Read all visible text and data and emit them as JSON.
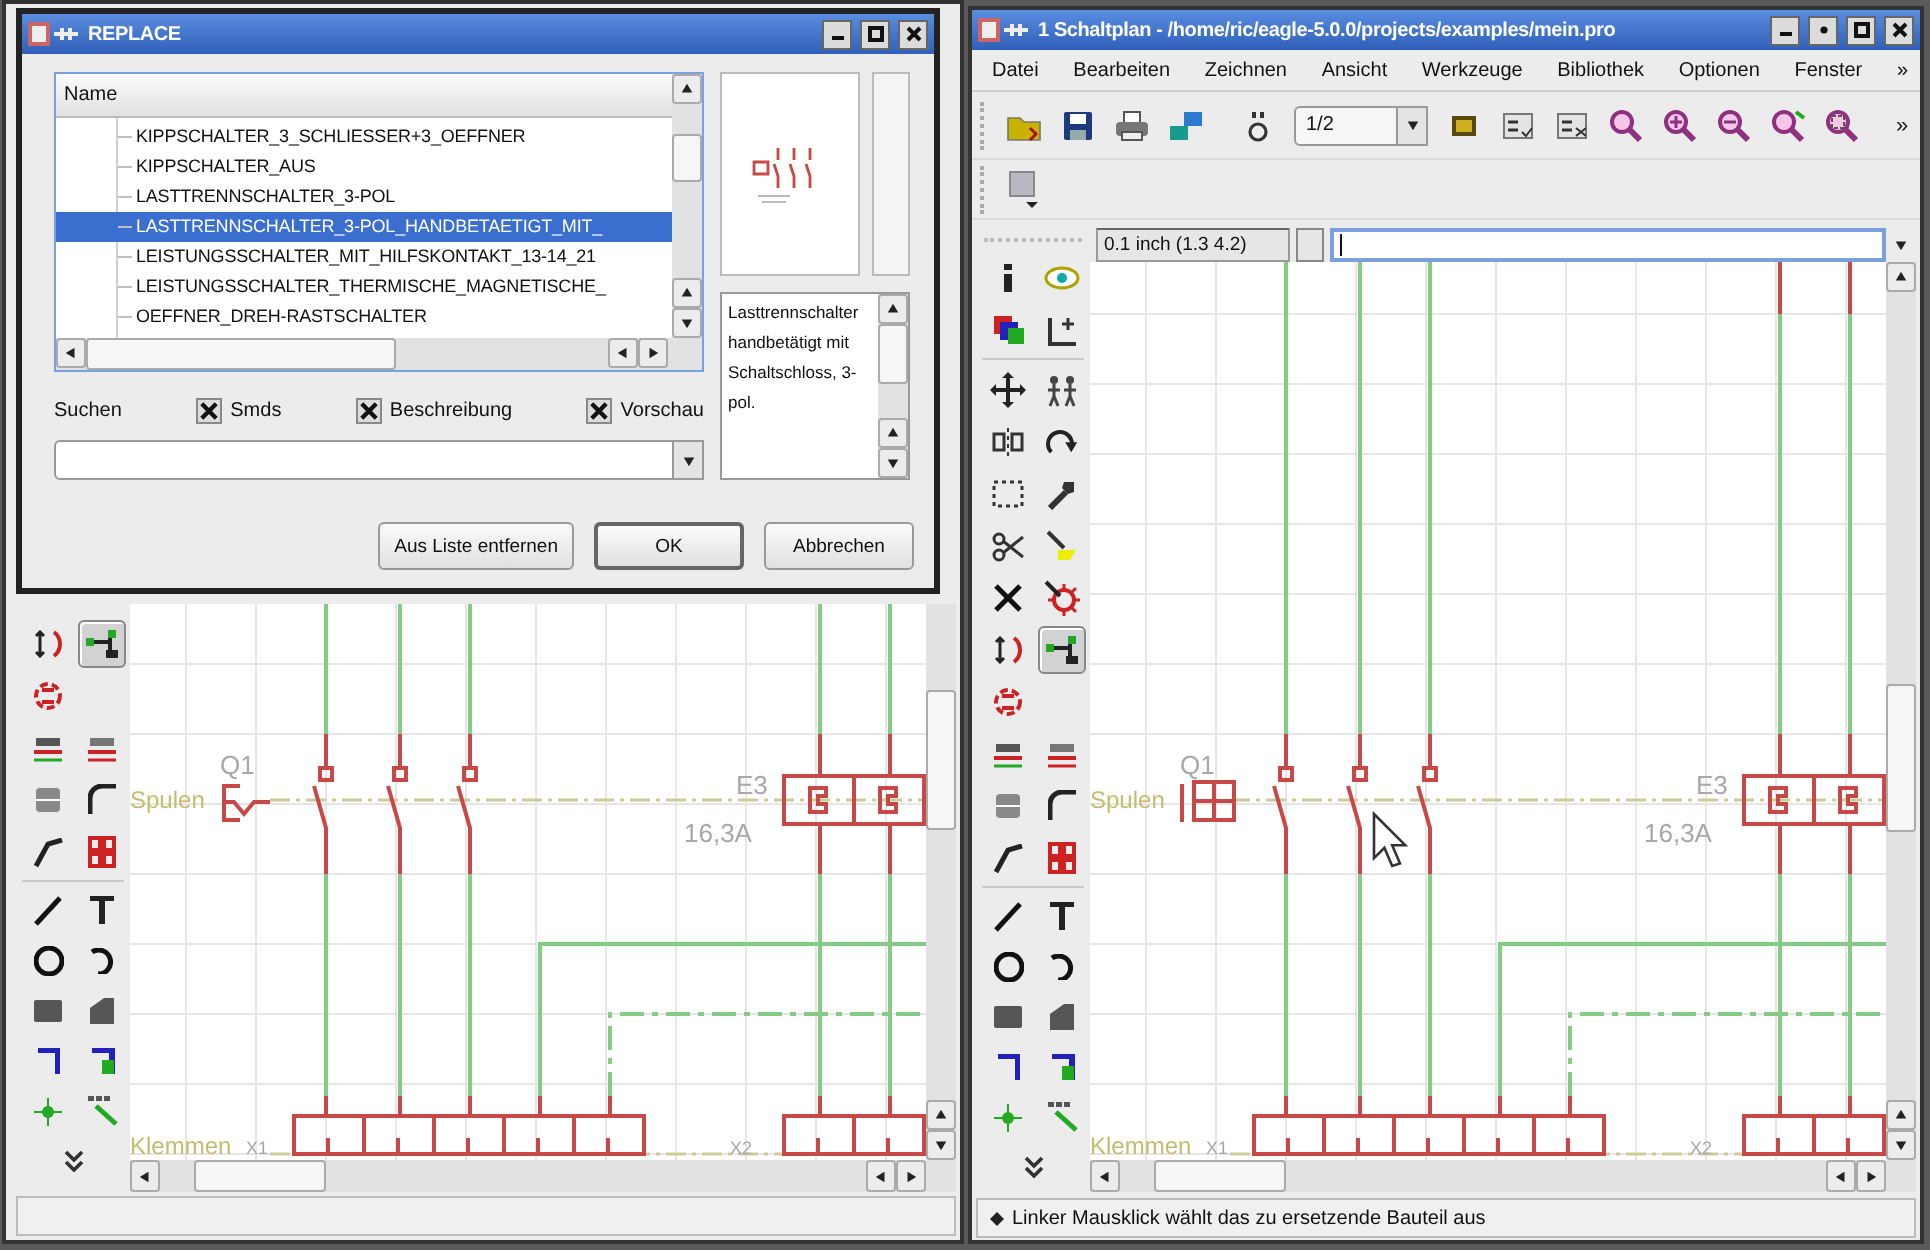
{
  "dialog": {
    "title": "REPLACE",
    "list": {
      "header": "Name",
      "items": [
        {
          "text": "KIPPSCHALTER_3_SCHLIESSER+3_OEFFNER",
          "selected": false
        },
        {
          "text": "KIPPSCHALTER_AUS",
          "selected": false
        },
        {
          "text": "LASTTRENNSCHALTER_3-POL",
          "selected": false
        },
        {
          "text": "LASTTRENNSCHALTER_3-POL_HANDBETAETIGT_MIT_",
          "selected": true
        },
        {
          "text": "LEISTUNGSSCHALTER_MIT_HILFSKONTAKT_13-14_21",
          "selected": false
        },
        {
          "text": "LEISTUNGSSCHALTER_THERMISCHE_MAGNETISCHE_",
          "selected": false
        },
        {
          "text": "OEFFNER_DREH-RASTSCHALTER",
          "selected": false
        }
      ]
    },
    "description": "Lasttrennschalter handbetätigt mit Schaltschloss, 3-pol.",
    "search_label": "Suchen",
    "options": [
      {
        "label": "Smds",
        "checked": true
      },
      {
        "label": "Beschreibung",
        "checked": true
      },
      {
        "label": "Vorschau",
        "checked": true
      }
    ],
    "buttons": [
      {
        "label": "Aus Liste entfernen",
        "default": false
      },
      {
        "label": "OK",
        "default": true
      },
      {
        "label": "Abbrechen",
        "default": false
      }
    ]
  },
  "left_window": {
    "palette": [
      [
        [
          {
            "kind": "pinswap",
            "selected": false
          },
          {
            "kind": "replace",
            "selected": true
          }
        ],
        [
          {
            "kind": "gateswap",
            "selected": false
          }
        ],
        [
          {
            "kind": "name",
            "selected": false
          },
          {
            "kind": "value",
            "selected": false
          }
        ],
        [
          {
            "kind": "smash",
            "selected": false
          },
          {
            "kind": "miter",
            "selected": false
          }
        ],
        [
          {
            "kind": "split",
            "selected": false
          },
          {
            "kind": "invoke",
            "selected": false
          }
        ]
      ],
      [
        [
          {
            "kind": "wire",
            "selected": false
          },
          {
            "kind": "text",
            "selected": false
          }
        ],
        [
          {
            "kind": "circle",
            "selected": false
          },
          {
            "kind": "arc",
            "selected": false
          }
        ],
        [
          {
            "kind": "rect",
            "selected": false
          },
          {
            "kind": "polygon",
            "selected": false
          }
        ],
        [
          {
            "kind": "net",
            "selected": false
          },
          {
            "kind": "bus",
            "selected": false
          }
        ],
        [
          {
            "kind": "junction",
            "selected": false
          },
          {
            "kind": "label",
            "selected": false
          }
        ],
        [
          {
            "kind": "more",
            "selected": false
          }
        ]
      ]
    ],
    "schematic": {
      "breaker": {
        "kind": "hand",
        "name": "Q1"
      },
      "fuse": "E3",
      "fuse_rating": "16,3A",
      "coil_group": "Spulen",
      "terminal_group": "Klemmen",
      "terminals": [
        "X1",
        "X2"
      ]
    }
  },
  "right_window": {
    "title": "1 Schaltplan - /home/ric/eagle-5.0.0/projects/examples/mein.pro",
    "menu": [
      "Datei",
      "Bearbeiten",
      "Zeichnen",
      "Ansicht",
      "Werkzeuge",
      "Bibliothek",
      "Optionen",
      "Fenster"
    ],
    "menu_more": "»",
    "sheet": "1/2",
    "toolbar_more": "»",
    "grid": "0.1 inch (1.3 4.2)",
    "palette": [
      [
        [
          {
            "kind": "info",
            "selected": false
          },
          {
            "kind": "show",
            "selected": false
          }
        ],
        [
          {
            "kind": "display",
            "selected": false
          },
          {
            "kind": "mark",
            "selected": false
          }
        ]
      ],
      [
        [
          {
            "kind": "move",
            "selected": false
          },
          {
            "kind": "copy",
            "selected": false
          }
        ],
        [
          {
            "kind": "mirror",
            "selected": false
          },
          {
            "kind": "rotate",
            "selected": false
          }
        ],
        [
          {
            "kind": "group",
            "selected": false
          },
          {
            "kind": "change",
            "selected": false
          }
        ],
        [
          {
            "kind": "cut",
            "selected": false
          },
          {
            "kind": "paste",
            "selected": false
          }
        ],
        [
          {
            "kind": "delete",
            "selected": false
          },
          {
            "kind": "add",
            "selected": false
          }
        ],
        [
          {
            "kind": "pinswap",
            "selected": false
          },
          {
            "kind": "replace",
            "selected": true
          }
        ],
        [
          {
            "kind": "gateswap",
            "selected": false
          }
        ],
        [
          {
            "kind": "name",
            "selected": false
          },
          {
            "kind": "value",
            "selected": false
          }
        ],
        [
          {
            "kind": "smash",
            "selected": false
          },
          {
            "kind": "miter",
            "selected": false
          }
        ],
        [
          {
            "kind": "split",
            "selected": false
          },
          {
            "kind": "invoke",
            "selected": false
          }
        ]
      ],
      [
        [
          {
            "kind": "wire",
            "selected": false
          },
          {
            "kind": "text",
            "selected": false
          }
        ],
        [
          {
            "kind": "circle",
            "selected": false
          },
          {
            "kind": "arc",
            "selected": false
          }
        ],
        [
          {
            "kind": "rect",
            "selected": false
          },
          {
            "kind": "polygon",
            "selected": false
          }
        ],
        [
          {
            "kind": "net",
            "selected": false
          },
          {
            "kind": "bus",
            "selected": false
          }
        ],
        [
          {
            "kind": "junction",
            "selected": false
          },
          {
            "kind": "label",
            "selected": false
          }
        ],
        [
          {
            "kind": "more",
            "selected": false
          }
        ]
      ]
    ],
    "schematic": {
      "breaker": {
        "kind": "box",
        "name": "Q1"
      },
      "fuse": "E3",
      "fuse_rating": "16,3A",
      "coil_group": "Spulen",
      "terminal_group": "Klemmen",
      "terminals": [
        "X1",
        "X2"
      ]
    },
    "status": "Linker Mausklick wählt das zu ersetzende Bauteil aus"
  }
}
